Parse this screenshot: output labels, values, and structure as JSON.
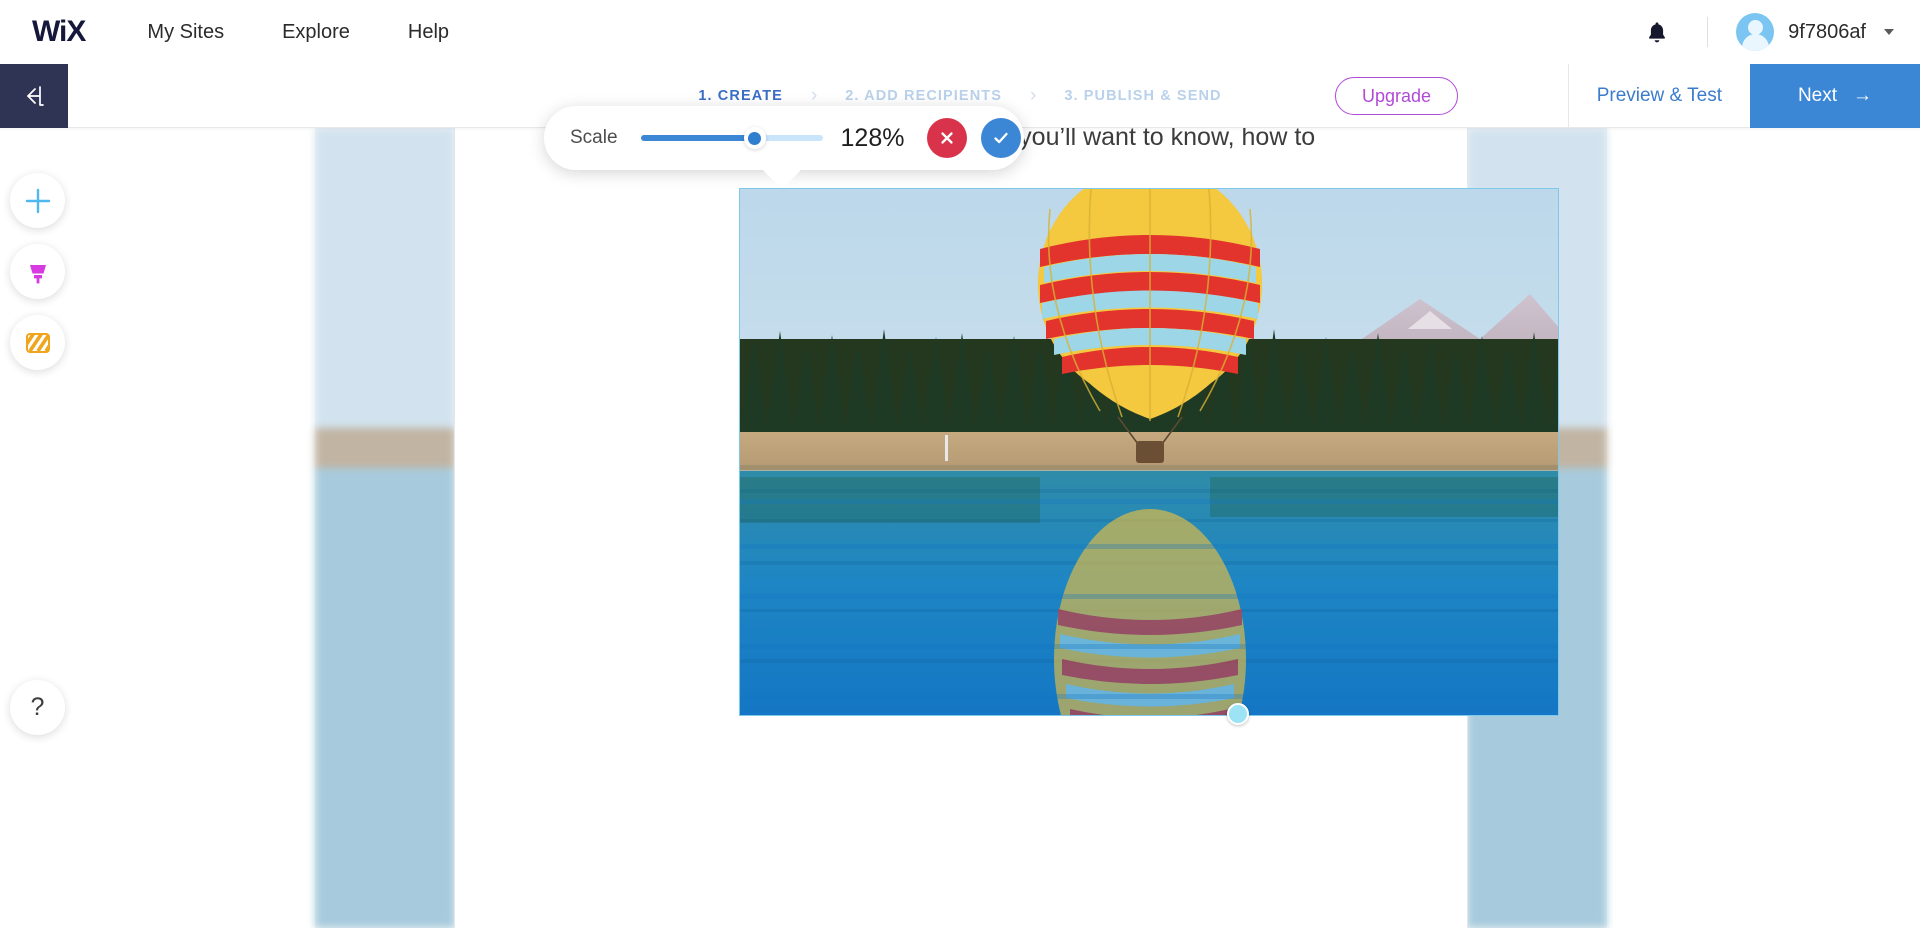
{
  "topbar": {
    "logo": "WiX",
    "nav": [
      {
        "label": "My Sites"
      },
      {
        "label": "Explore"
      },
      {
        "label": "Help"
      }
    ],
    "notifications_icon": "bell-icon",
    "user": {
      "name": "9f7806af",
      "avatar_icon": "user-avatar-icon",
      "caret_icon": "chevron-down-icon"
    }
  },
  "editorbar": {
    "back_icon": "back-arrow-icon",
    "steps": [
      {
        "label": "1. CREATE",
        "active": true
      },
      {
        "label": "2. ADD RECIPIENTS",
        "active": false
      },
      {
        "label": "3. PUBLISH & SEND",
        "active": false
      }
    ],
    "step_separator": "›",
    "upgrade_label": "Upgrade",
    "preview_label": "Preview & Test",
    "next_label": "Next",
    "next_arrow": "→",
    "colors": {
      "active_step": "#3a6ec4",
      "inactive_step": "#b9d1ea",
      "upgrade": "#b14ad6",
      "next_bg": "#3b87d6",
      "back_bg": "#2f3354"
    }
  },
  "sidebar": {
    "items": [
      {
        "name": "add",
        "icon": "plus-icon",
        "color": "#4eb8ef"
      },
      {
        "name": "design",
        "icon": "paint-brush-icon",
        "color": "#d63ae0"
      },
      {
        "name": "background",
        "icon": "stripes-background-icon",
        "color": "#efa51e"
      }
    ],
    "help": {
      "label": "?",
      "icon": "help-icon"
    }
  },
  "canvas": {
    "headline": "Every email has a story. Here’s what you’ll want to know, how to",
    "image": {
      "alt": "hot air balloon over lake with forest and mountains",
      "selected": true,
      "handle_icon": "resize-handle"
    }
  },
  "scale_popup": {
    "label": "Scale",
    "value": "128%",
    "slider": {
      "percent": 62,
      "min_label": "",
      "max_label": ""
    },
    "cancel_icon": "close-icon",
    "confirm_icon": "check-icon",
    "colors": {
      "cancel": "#d8334a",
      "confirm": "#3b87d6",
      "track": "#3b87d6"
    }
  }
}
